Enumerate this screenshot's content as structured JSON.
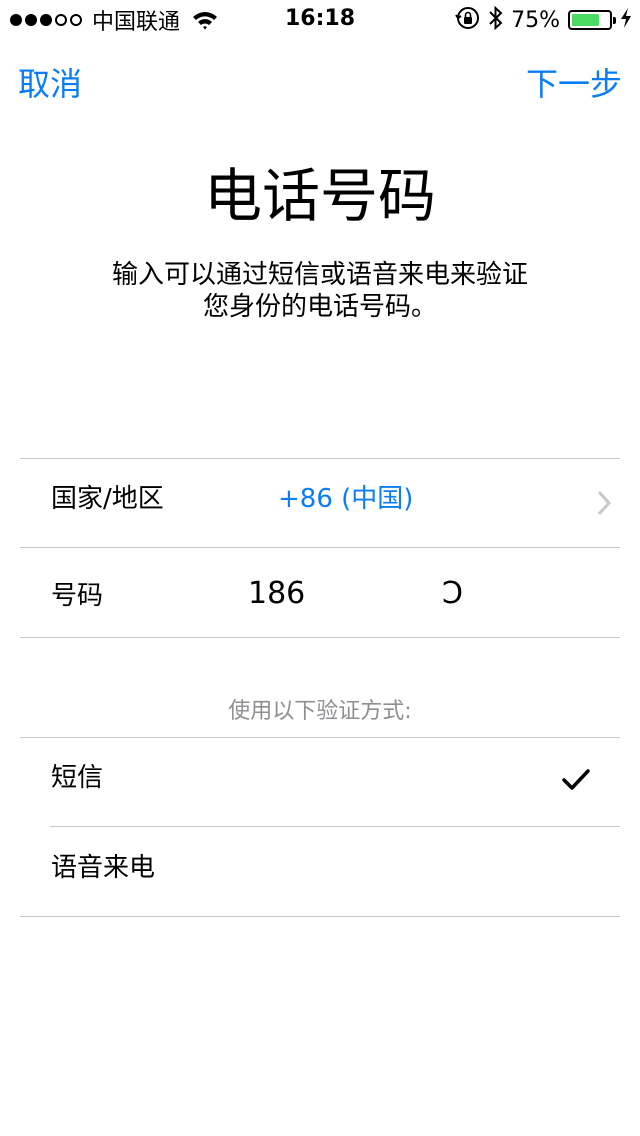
{
  "status_bar": {
    "signal_filled": 3,
    "signal_total": 5,
    "carrier": "中国联通",
    "time": "16:18",
    "battery_percent": "75%",
    "battery_level": 0.75,
    "battery_color": "#4cd964"
  },
  "nav": {
    "cancel_label": "取消",
    "next_label": "下一步",
    "accent_color": "#0a7df2"
  },
  "header": {
    "title": "电话号码",
    "subtitle_line1": "输入可以通过短信或语音来电来验证",
    "subtitle_line2": "您身份的电话号码。"
  },
  "form": {
    "country_label": "国家/地区",
    "country_value": "+86 (中国)",
    "number_label": "号码",
    "number_value": "186",
    "number_tail": "Ↄ"
  },
  "verification": {
    "header": "使用以下验证方式:",
    "options": [
      {
        "label": "短信",
        "selected": true
      },
      {
        "label": "语音来电",
        "selected": false
      }
    ]
  },
  "icons": {
    "wifi": "wifi-icon",
    "orientation_lock": "orientation-lock-icon",
    "bluetooth": "bluetooth-icon",
    "battery": "battery-icon",
    "charging": "charging-bolt-icon",
    "chevron": "chevron-right-icon",
    "check": "checkmark-icon"
  }
}
